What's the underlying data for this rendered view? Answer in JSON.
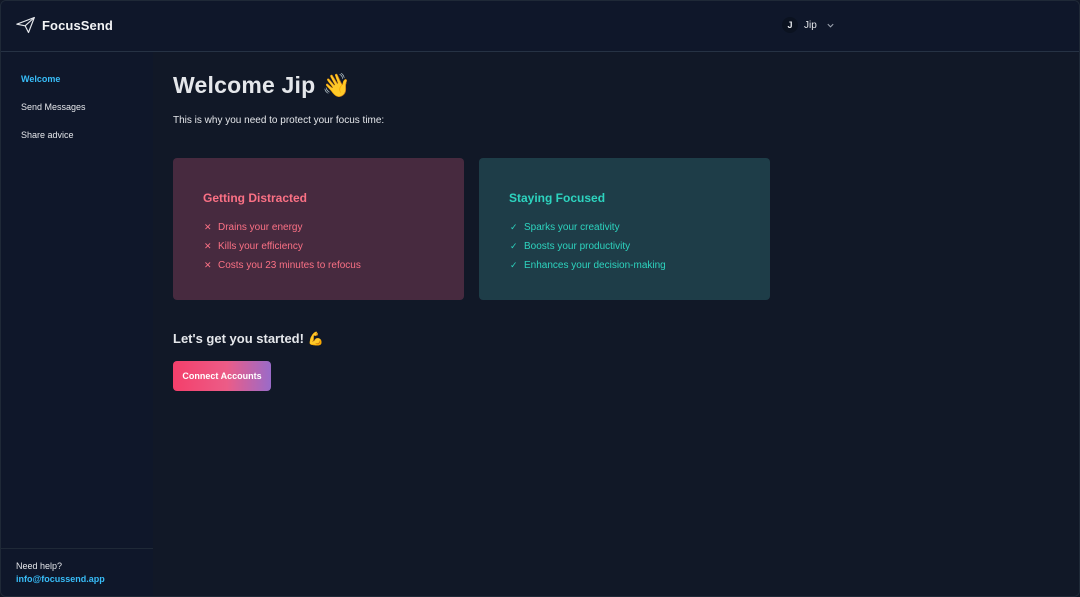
{
  "app": {
    "name": "FocusSend",
    "logo_icon": "paper-plane-icon"
  },
  "user": {
    "initial": "J",
    "name": "Jip",
    "menu_icon": "chevron-down-icon"
  },
  "sidebar": {
    "items": [
      {
        "label": "Welcome",
        "active": true
      },
      {
        "label": "Send Messages",
        "active": false
      },
      {
        "label": "Share advice",
        "active": false
      }
    ],
    "help": {
      "label": "Need help?",
      "email": "info@focussend.app"
    }
  },
  "main": {
    "title": "Welcome Jip 👋",
    "subtitle": "This is why you need to protect your focus time:",
    "cards": {
      "distracted": {
        "title": "Getting Distracted",
        "marker": "✕",
        "items": [
          "Drains your energy",
          "Kills your efficiency",
          "Costs you 23 minutes to refocus"
        ]
      },
      "focused": {
        "title": "Staying Focused",
        "marker": "✓",
        "items": [
          "Sparks your creativity",
          "Boosts your productivity",
          "Enhances your decision-making"
        ]
      }
    },
    "started_heading": "Let's get you started! 💪",
    "cta_label": "Connect Accounts"
  },
  "colors": {
    "background": "#111827",
    "sidebar": "#0f172a",
    "accent": "#38bdf8",
    "negative": "#fb7185",
    "negative_bg": "#472a3f",
    "positive": "#2dd4bf",
    "positive_bg": "#1e3d48",
    "cta_gradient_start": "#f43f6b",
    "cta_gradient_end": "#9a6bc9"
  }
}
